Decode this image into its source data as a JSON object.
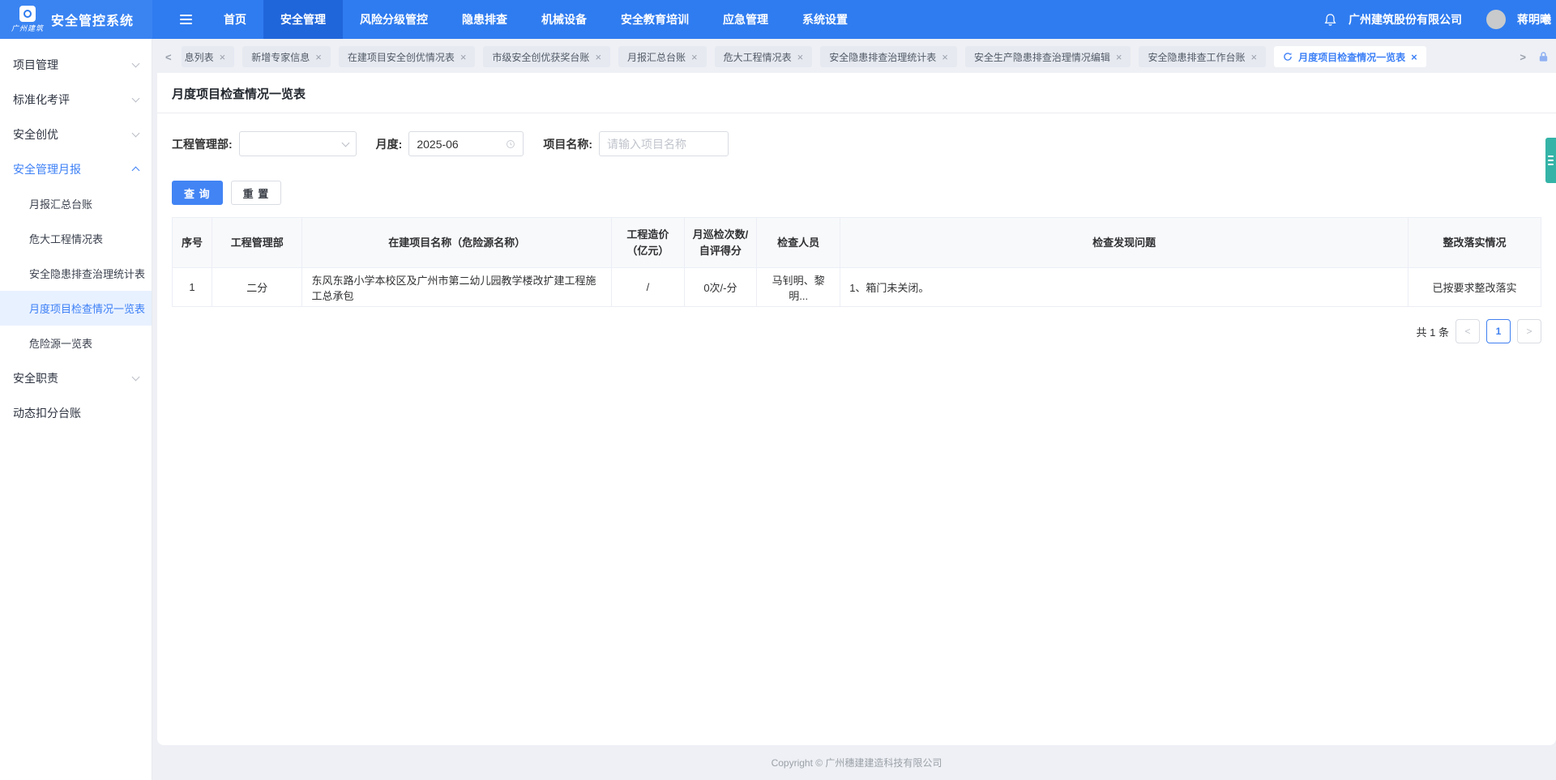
{
  "header": {
    "logo_text": "广州建筑",
    "app_title": "安全管控系统",
    "nav": [
      {
        "label": "首页"
      },
      {
        "label": "安全管理"
      },
      {
        "label": "风险分级管控"
      },
      {
        "label": "隐患排查"
      },
      {
        "label": "机械设备"
      },
      {
        "label": "安全教育培训"
      },
      {
        "label": "应急管理"
      },
      {
        "label": "系统设置"
      }
    ],
    "company": "广州建筑股份有限公司",
    "user_name": "蒋明曦"
  },
  "sidebar": {
    "items": [
      {
        "label": "项目管理"
      },
      {
        "label": "标准化考评"
      },
      {
        "label": "安全创优"
      },
      {
        "label": "安全管理月报"
      },
      {
        "label": "安全职责"
      },
      {
        "label": "动态扣分台账"
      }
    ],
    "month_report_children": [
      {
        "label": "月报汇总台账"
      },
      {
        "label": "危大工程情况表"
      },
      {
        "label": "安全隐患排查治理统计表"
      },
      {
        "label": "月度项目检查情况一览表"
      },
      {
        "label": "危险源一览表"
      }
    ]
  },
  "tabs": [
    {
      "label": "息列表"
    },
    {
      "label": "新增专家信息"
    },
    {
      "label": "在建项目安全创优情况表"
    },
    {
      "label": "市级安全创优获奖台账"
    },
    {
      "label": "月报汇总台账"
    },
    {
      "label": "危大工程情况表"
    },
    {
      "label": "安全隐患排查治理统计表"
    },
    {
      "label": "安全生产隐患排查治理情况编辑"
    },
    {
      "label": "安全隐患排查工作台账"
    },
    {
      "label": "月度项目检查情况一览表"
    }
  ],
  "page": {
    "title": "月度项目检查情况一览表"
  },
  "filters": {
    "dept_label": "工程管理部:",
    "month_label": "月度:",
    "month_value": "2025-06",
    "project_label": "项目名称:",
    "project_placeholder": "请输入项目名称"
  },
  "actions": {
    "search": "查 询",
    "reset": "重 置"
  },
  "table": {
    "columns": [
      "序号",
      "工程管理部",
      "在建项目名称（危险源名称）",
      "工程造价\n（亿元）",
      "月巡检次数/\n自评得分",
      "检查人员",
      "检查发现问题",
      "整改落实情况"
    ],
    "rows": [
      [
        "1",
        "二分",
        "东风东路小学本校区及广州市第二幼儿园教学楼改扩建工程施工总承包",
        "/",
        "0次/-分",
        "马钊明、黎明...",
        "1、箱门未关闭。",
        "已按要求整改落实"
      ]
    ]
  },
  "pagination": {
    "total": "共 1 条",
    "page": "1"
  },
  "footer": {
    "copyright": "Copyright © 广州穗建建造科技有限公司"
  },
  "colors": {
    "header_blue": "#2f7cf0",
    "active_nav": "#2066db",
    "accent": "#3d80f6",
    "widget_teal": "#35b3a7"
  }
}
